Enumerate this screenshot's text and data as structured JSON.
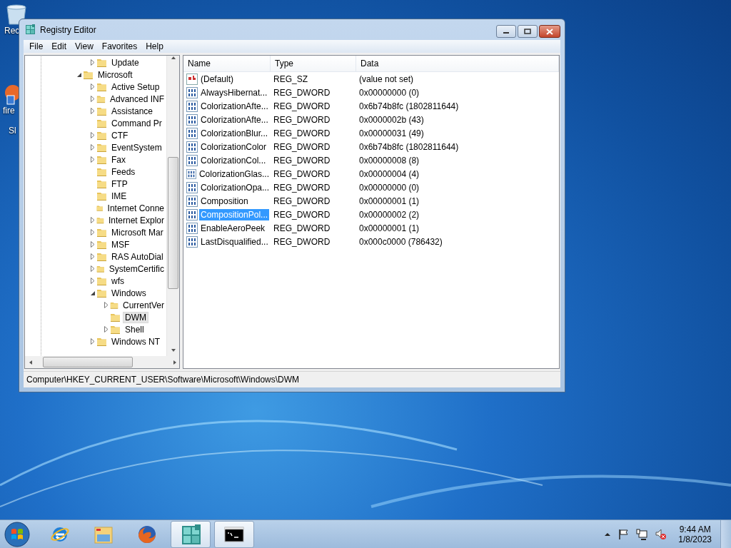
{
  "desktop_icons": [
    {
      "label": "Rec",
      "kind": "recycle-bin"
    },
    {
      "label": "fire",
      "kind": "shortcut"
    },
    {
      "label": "Sl",
      "kind": "none"
    }
  ],
  "window": {
    "title": "Registry Editor"
  },
  "menu": [
    "File",
    "Edit",
    "View",
    "Favorites",
    "Help"
  ],
  "tree": {
    "items": [
      {
        "children": [
          {
            "label": "Update",
            "expanded": false,
            "selected": false
          }
        ]
      },
      {
        "label": "Microsoft",
        "expanded": true,
        "selected": false,
        "children": [
          {
            "label": "Active Setup",
            "expanded": false,
            "selected": false
          },
          {
            "label": "Advanced INF",
            "expanded": false,
            "selected": false
          },
          {
            "label": "Assistance",
            "expanded": false,
            "selected": false
          },
          {
            "label": "Command Pr",
            "selected": false
          },
          {
            "label": "CTF",
            "expanded": false,
            "selected": false
          },
          {
            "label": "EventSystem",
            "expanded": false,
            "selected": false
          },
          {
            "label": "Fax",
            "expanded": false,
            "selected": false
          },
          {
            "label": "Feeds",
            "selected": false
          },
          {
            "label": "FTP",
            "selected": false
          },
          {
            "label": "IME",
            "selected": false
          },
          {
            "label": "Internet Conne",
            "selected": false
          },
          {
            "label": "Internet Explor",
            "expanded": false,
            "selected": false
          },
          {
            "label": "Microsoft Mar",
            "expanded": false,
            "selected": false
          },
          {
            "label": "MSF",
            "expanded": false,
            "selected": false
          },
          {
            "label": "RAS AutoDial",
            "expanded": false,
            "selected": false
          },
          {
            "label": "SystemCertific",
            "expanded": false,
            "selected": false
          },
          {
            "label": "wfs",
            "expanded": false,
            "selected": false
          },
          {
            "label": "Windows",
            "expanded": true,
            "selected": false,
            "children": [
              {
                "label": "CurrentVer",
                "expanded": false,
                "selected": false
              },
              {
                "label": "DWM",
                "selected": true
              },
              {
                "label": "Shell",
                "expanded": false,
                "selected": false
              }
            ]
          },
          {
            "label": "Windows NT",
            "expanded": false,
            "selected": false
          }
        ]
      }
    ]
  },
  "list": {
    "columns": [
      "Name",
      "Type",
      "Data"
    ],
    "rows": [
      {
        "kind": "string",
        "name": "(Default)",
        "type": "REG_SZ",
        "data": "(value not set)",
        "selected": false
      },
      {
        "kind": "number",
        "name": "AlwaysHibernat...",
        "type": "REG_DWORD",
        "data": "0x00000000 (0)",
        "selected": false
      },
      {
        "kind": "number",
        "name": "ColorizationAfte...",
        "type": "REG_DWORD",
        "data": "0x6b74b8fc (1802811644)",
        "selected": false
      },
      {
        "kind": "number",
        "name": "ColorizationAfte...",
        "type": "REG_DWORD",
        "data": "0x0000002b (43)",
        "selected": false
      },
      {
        "kind": "number",
        "name": "ColorizationBlur...",
        "type": "REG_DWORD",
        "data": "0x00000031 (49)",
        "selected": false
      },
      {
        "kind": "number",
        "name": "ColorizationColor",
        "type": "REG_DWORD",
        "data": "0x6b74b8fc (1802811644)",
        "selected": false
      },
      {
        "kind": "number",
        "name": "ColorizationCol...",
        "type": "REG_DWORD",
        "data": "0x00000008 (8)",
        "selected": false
      },
      {
        "kind": "number",
        "name": "ColorizationGlas...",
        "type": "REG_DWORD",
        "data": "0x00000004 (4)",
        "selected": false
      },
      {
        "kind": "number",
        "name": "ColorizationOpa...",
        "type": "REG_DWORD",
        "data": "0x00000000 (0)",
        "selected": false
      },
      {
        "kind": "number",
        "name": "Composition",
        "type": "REG_DWORD",
        "data": "0x00000001 (1)",
        "selected": false
      },
      {
        "kind": "number",
        "name": "CompositionPol...",
        "type": "REG_DWORD",
        "data": "0x00000002 (2)",
        "selected": true
      },
      {
        "kind": "number",
        "name": "EnableAeroPeek",
        "type": "REG_DWORD",
        "data": "0x00000001 (1)",
        "selected": false
      },
      {
        "kind": "number",
        "name": "LastDisqualified...",
        "type": "REG_DWORD",
        "data": "0x000c0000 (786432)",
        "selected": false
      }
    ]
  },
  "status_bar": "Computer\\HKEY_CURRENT_USER\\Software\\Microsoft\\Windows\\DWM",
  "taskbar": {
    "buttons": [
      {
        "kind": "browser-e",
        "selected": false
      },
      {
        "kind": "folders",
        "selected": false
      },
      {
        "kind": "fox",
        "selected": false
      },
      {
        "kind": "cubes",
        "selected": true
      },
      {
        "kind": "console",
        "selected": true
      }
    ],
    "time": "9:44 AM",
    "date": "1/8/2023"
  }
}
